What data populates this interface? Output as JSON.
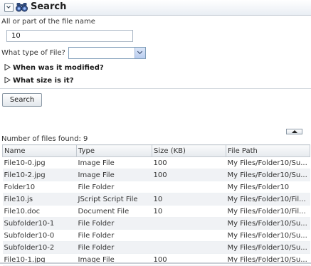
{
  "header": {
    "title": "Search"
  },
  "form": {
    "name_label": "All or part of the file name",
    "name_value": "10",
    "type_label": "What type of File?",
    "type_value": "",
    "modified_label": "When was it modified?",
    "size_label": "What size is it?",
    "search_button": "Search"
  },
  "results": {
    "count_text": "Number of files found: 9",
    "columns": [
      "Name",
      "Type",
      "Size (KB)",
      "File Path"
    ],
    "rows": [
      [
        "File10-0.jpg",
        "Image File",
        "100",
        "My Files/Folder10/Su..."
      ],
      [
        "File10-2.jpg",
        "Image File",
        "100",
        "My Files/Folder10/Su..."
      ],
      [
        "Folder10",
        "File Folder",
        "",
        "My Files/Folder10"
      ],
      [
        "File10.js",
        "JScript Script File",
        "10",
        "My Files/Folder10/Fil..."
      ],
      [
        "File10.doc",
        "Document File",
        "10",
        "My Files/Folder10/Fil..."
      ],
      [
        "Subfolder10-1",
        "File Folder",
        "",
        "My Files/Folder10/Su..."
      ],
      [
        "Subfolder10-0",
        "File Folder",
        "",
        "My Files/Folder10/Su..."
      ],
      [
        "Subfolder10-2",
        "File Folder",
        "",
        "My Files/Folder10/Su..."
      ],
      [
        "File10-1.jpg",
        "Image File",
        "100",
        "My Files/Folder10/Su..."
      ]
    ]
  },
  "colors": {
    "header_bg": "#e9eef4",
    "row_alt": "#f0f2f5",
    "border": "#c3c9d0"
  },
  "icons": [
    "collapse-icon",
    "binoculars-icon",
    "expand-triangle-icon",
    "scroll-top-icon",
    "dropdown-arrow-icon"
  ]
}
